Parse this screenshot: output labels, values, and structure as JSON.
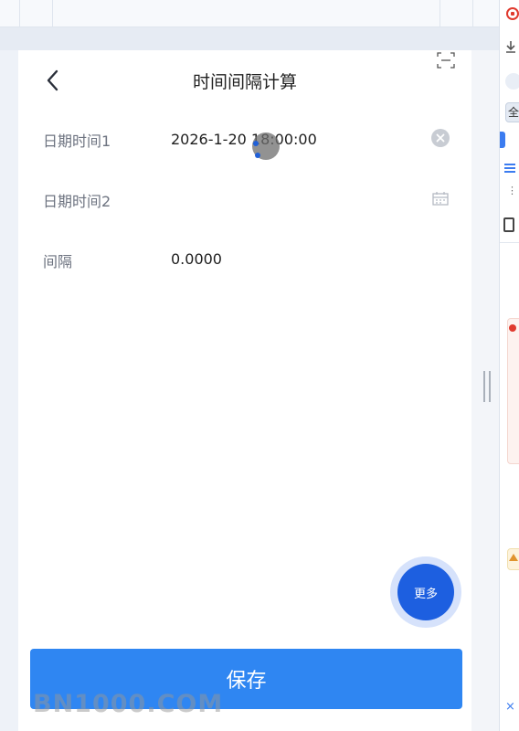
{
  "header": {
    "title": "时间间隔计算"
  },
  "fields": {
    "datetime1": {
      "label": "日期时间1",
      "value": "2026-1-20 18:00:00"
    },
    "datetime2": {
      "label": "日期时间2",
      "value": ""
    },
    "interval": {
      "label": "间隔",
      "value": "0.0000"
    }
  },
  "buttons": {
    "more_label": "更多",
    "save_label": "保存"
  },
  "side_panel": {
    "tab_label": "全"
  },
  "watermark": "BN1000.COM",
  "colors": {
    "primary": "#2f86f2",
    "fab": "#1d5fe0",
    "label": "#6d7380"
  }
}
